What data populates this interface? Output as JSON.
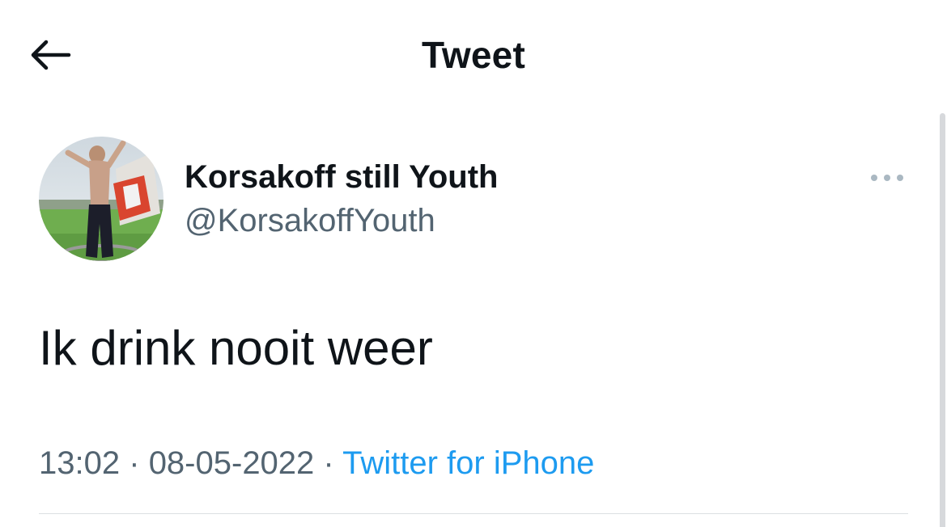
{
  "header": {
    "title": "Tweet",
    "back_icon": "arrow-left-icon"
  },
  "author": {
    "display_name": "Korsakoff still Youth",
    "handle": "@KorsakoffYouth",
    "more_icon": "more-horizontal-icon"
  },
  "tweet": {
    "text": "Ik drink nooit weer"
  },
  "meta": {
    "time": "13:02",
    "separator": "·",
    "date": "08-05-2022",
    "source": "Twitter for iPhone"
  },
  "colors": {
    "text_primary": "#0f1419",
    "text_secondary": "#536471",
    "link": "#1d9bf0",
    "divider": "#dcdfe2"
  }
}
